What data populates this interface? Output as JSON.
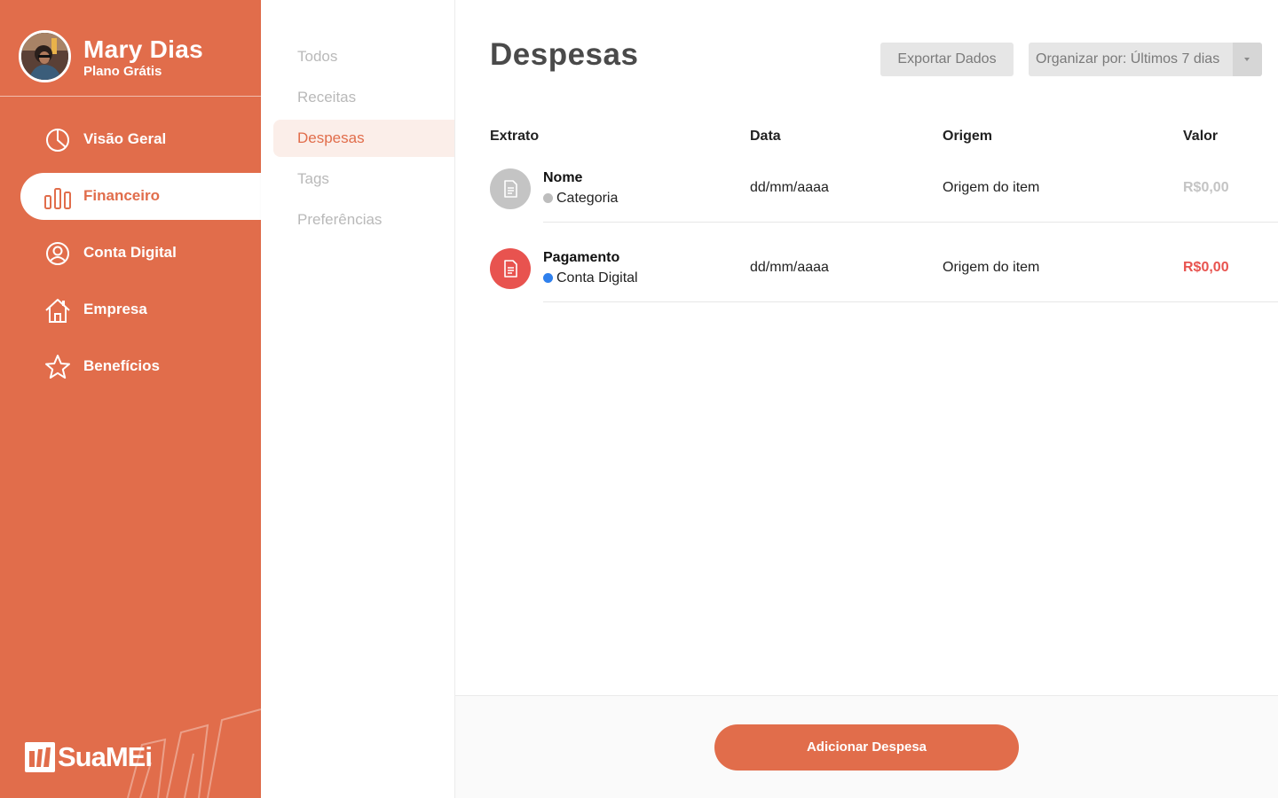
{
  "user": {
    "name": "Mary Dias",
    "plan": "Plano Grátis"
  },
  "sidebar": {
    "items": [
      {
        "label": "Visão Geral",
        "icon": "pie-chart-icon",
        "active": false
      },
      {
        "label": "Financeiro",
        "icon": "bar-chart-icon",
        "active": true
      },
      {
        "label": "Conta Digital",
        "icon": "user-circle-icon",
        "active": false
      },
      {
        "label": "Empresa",
        "icon": "house-icon",
        "active": false
      },
      {
        "label": "Benefícios",
        "icon": "star-icon",
        "active": false
      }
    ],
    "brand": "SuaMEi"
  },
  "subnav": {
    "items": [
      {
        "label": "Todos",
        "active": false
      },
      {
        "label": "Receitas",
        "active": false
      },
      {
        "label": "Despesas",
        "active": true
      },
      {
        "label": "Tags",
        "active": false
      },
      {
        "label": "Preferências",
        "active": false
      }
    ]
  },
  "main": {
    "title": "Despesas",
    "export_label": "Exportar Dados",
    "sort_label": "Organizar por: Últimos 7 dias",
    "columns": [
      "Extrato",
      "Data",
      "Origem",
      "Valor"
    ],
    "rows": [
      {
        "name": "Nome",
        "category": "Categoria",
        "category_color": "#bdbdbd",
        "icon_color": "#c4c4c4",
        "date": "dd/mm/aaaa",
        "origin": "Origem do item",
        "value": "R$0,00",
        "value_color": "#c4c4c4"
      },
      {
        "name": "Pagamento",
        "category": "Conta Digital",
        "category_color": "#2F80ED",
        "icon_color": "#E8534F",
        "date": "dd/mm/aaaa",
        "origin": "Origem do item",
        "value": "R$0,00",
        "value_color": "#E8534F"
      }
    ],
    "add_button": "Adicionar Despesa"
  },
  "colors": {
    "brand": "#E16D4B",
    "danger": "#E8534F",
    "muted": "#c4c4c4"
  }
}
